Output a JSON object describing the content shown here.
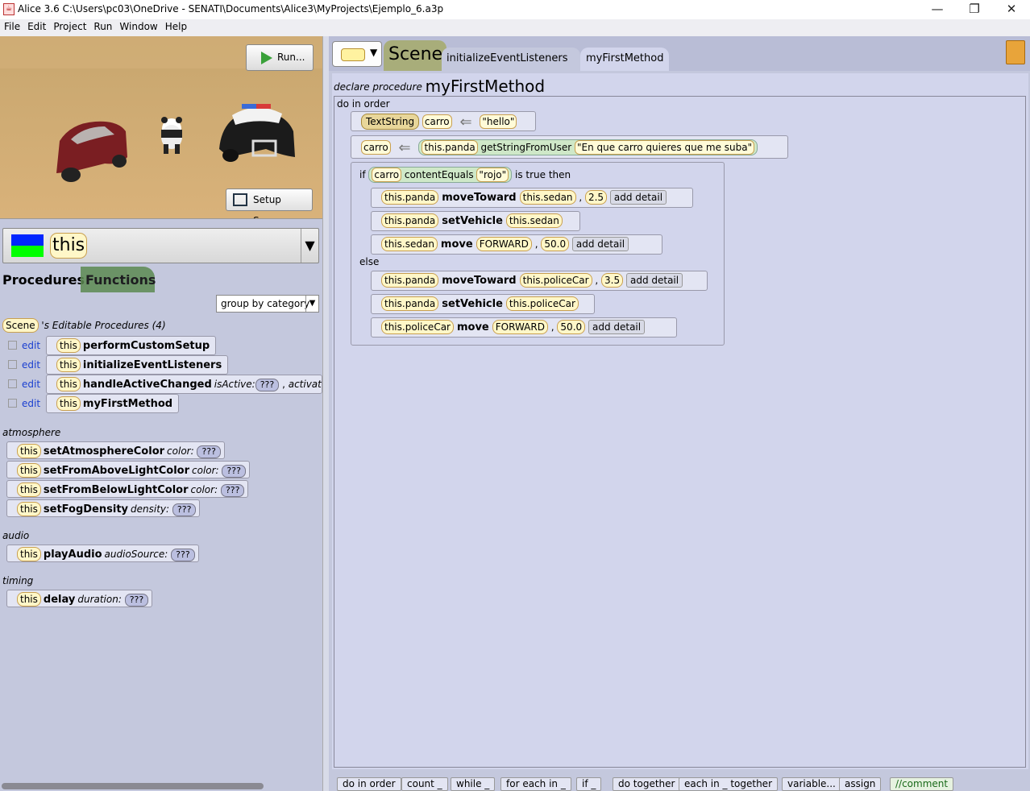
{
  "window": {
    "title": "Alice 3.6 C:\\Users\\pc03\\OneDrive - SENATI\\Documents\\Alice3\\MyProjects\\Ejemplo_6.a3p",
    "minimize": "—",
    "restore": "❐",
    "close": "✕"
  },
  "menu": [
    "File",
    "Edit",
    "Project",
    "Run",
    "Window",
    "Help"
  ],
  "scene": {
    "run_label": "Run...",
    "setup_label": "Setup Scene"
  },
  "selector": {
    "label": "this",
    "arrow": "▼"
  },
  "tabs": {
    "procedures": "Procedures",
    "functions": "Functions"
  },
  "group_select": "group by category",
  "editable": {
    "owner": "Scene",
    "title": "'s Editable Procedures (4)",
    "edit": "edit",
    "this": "this",
    "items": [
      {
        "name": "performCustomSetup"
      },
      {
        "name": "initializeEventListeners"
      },
      {
        "name": "handleActiveChanged",
        "param1": "isActive:",
        "val1": "???",
        "sep": ",",
        "param2": "activation"
      },
      {
        "name": "myFirstMethod"
      }
    ]
  },
  "categories": [
    {
      "name": "atmosphere",
      "items": [
        {
          "name": "setAtmosphereColor",
          "param": "color:",
          "val": "???"
        },
        {
          "name": "setFromAboveLightColor",
          "param": "color:",
          "val": "???"
        },
        {
          "name": "setFromBelowLightColor",
          "param": "color:",
          "val": "???"
        },
        {
          "name": "setFogDensity",
          "param": "density:",
          "val": "???"
        }
      ]
    },
    {
      "name": "audio",
      "items": [
        {
          "name": "playAudio",
          "param": "audioSource:",
          "val": "???"
        }
      ]
    },
    {
      "name": "timing",
      "items": [
        {
          "name": "delay",
          "param": "duration:",
          "val": "???"
        }
      ]
    }
  ],
  "editor": {
    "tabs": {
      "scene": "Scene",
      "iel": "initializeEventListeners",
      "method": "myFirstMethod"
    },
    "declare": "declare procedure",
    "method_name": "myFirstMethod",
    "do_in_order": "do in order",
    "stmt1": {
      "type": "TextString",
      "var": "carro",
      "val": "\"hello\""
    },
    "stmt2": {
      "var": "carro",
      "obj": "this.panda",
      "fn": "getStringFromUser",
      "arg": "\"En que carro quieres que me suba\""
    },
    "if": {
      "kw": "if",
      "var": "carro",
      "fn": "contentEquals",
      "arg": "\"rojo\"",
      "then": "is true then",
      "else": "else"
    },
    "then_rows": [
      {
        "obj": "this.panda",
        "m": "moveToward",
        "a": "this.sedan",
        "n": "2.5",
        "d": "add detail"
      },
      {
        "obj": "this.panda",
        "m": "setVehicle",
        "a": "this.sedan"
      },
      {
        "obj": "this.sedan",
        "m": "move",
        "a": "FORWARD",
        "n": "50.0",
        "d": "add detail"
      }
    ],
    "else_rows": [
      {
        "obj": "this.panda",
        "m": "moveToward",
        "a": "this.policeCar",
        "n": "3.5",
        "d": "add detail"
      },
      {
        "obj": "this.panda",
        "m": "setVehicle",
        "a": "this.policeCar"
      },
      {
        "obj": "this.policeCar",
        "m": "move",
        "a": "FORWARD",
        "n": "50.0",
        "d": "add detail"
      }
    ]
  },
  "controls": [
    "do in order",
    "count _",
    "while _",
    "for each in _",
    "if _",
    "do together",
    "each in _ together",
    "variable...",
    "assign",
    "//comment"
  ]
}
